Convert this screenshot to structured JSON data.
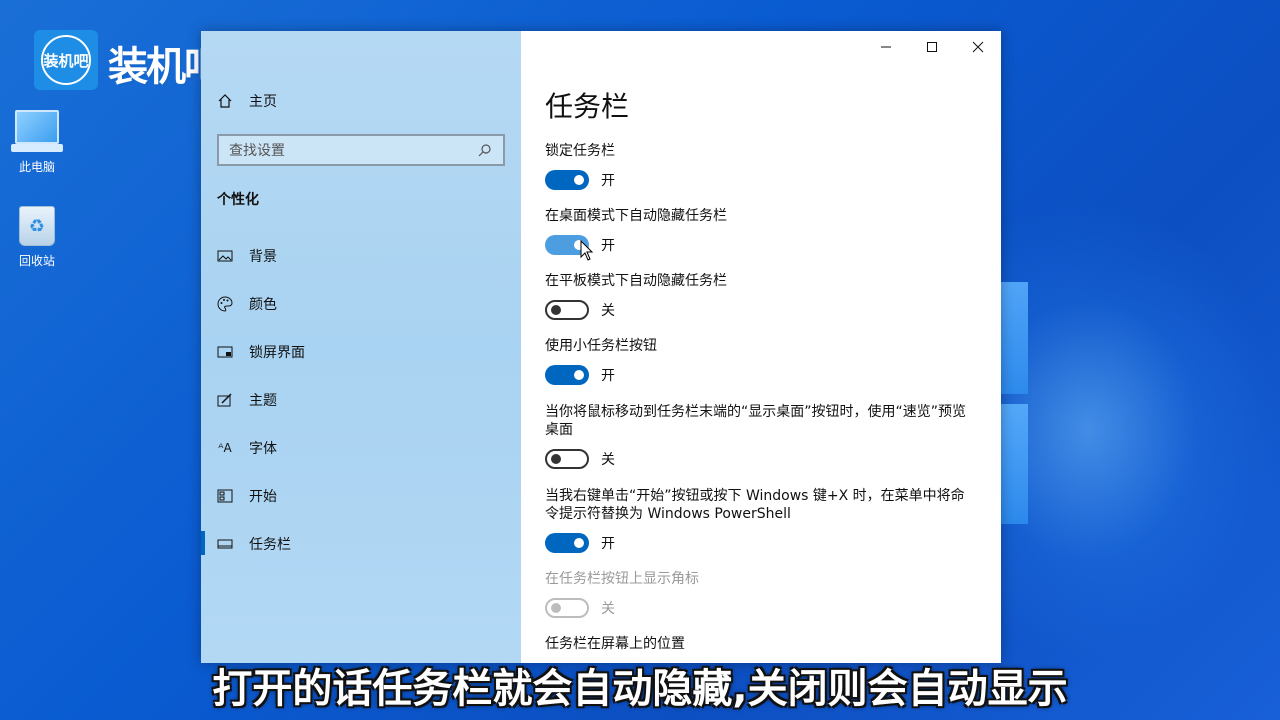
{
  "brand": {
    "logo_badge": "装机吧",
    "logo_text": "装机吧"
  },
  "desktop": {
    "icons": [
      {
        "label": "此电脑",
        "icon": "computer-icon"
      },
      {
        "label": "回收站",
        "icon": "recycle-bin-icon"
      }
    ]
  },
  "window": {
    "caption": {
      "minimize": "—",
      "maximize": "☐",
      "close": "✕"
    },
    "sidebar": {
      "home_label": "主页",
      "search_placeholder": "查找设置",
      "section_title": "个性化",
      "items": [
        {
          "label": "背景",
          "icon": "image-icon"
        },
        {
          "label": "颜色",
          "icon": "palette-icon"
        },
        {
          "label": "锁屏界面",
          "icon": "lock-screen-icon"
        },
        {
          "label": "主题",
          "icon": "theme-icon"
        },
        {
          "label": "字体",
          "icon": "font-icon"
        },
        {
          "label": "开始",
          "icon": "start-icon"
        },
        {
          "label": "任务栏",
          "icon": "taskbar-icon",
          "active": true
        }
      ]
    },
    "content": {
      "title": "任务栏",
      "settings": [
        {
          "label": "锁定任务栏",
          "state": "开",
          "on": true
        },
        {
          "label": "在桌面模式下自动隐藏任务栏",
          "state": "开",
          "on": true
        },
        {
          "label": "在平板模式下自动隐藏任务栏",
          "state": "关",
          "on": false
        },
        {
          "label": "使用小任务栏按钮",
          "state": "开",
          "on": true
        },
        {
          "label": "当你将鼠标移动到任务栏末端的“显示桌面”按钮时，使用“速览”预览桌面",
          "state": "关",
          "on": false
        },
        {
          "label": "当我右键单击“开始”按钮或按下 Windows 键+X 时，在菜单中将命令提示符替换为 Windows PowerShell",
          "state": "开",
          "on": true
        },
        {
          "label": "在任务栏按钮上显示角标",
          "state": "关",
          "on": false,
          "disabled": true
        },
        {
          "label": "任务栏在屏幕上的位置"
        }
      ]
    }
  },
  "subtitle": "打开的话任务栏就会自动隐藏,关闭则会自动显示",
  "colors": {
    "accent": "#0067c0",
    "sidebar_bg": "#b2d8f4",
    "desktop_bg": "#0a5bd1"
  }
}
